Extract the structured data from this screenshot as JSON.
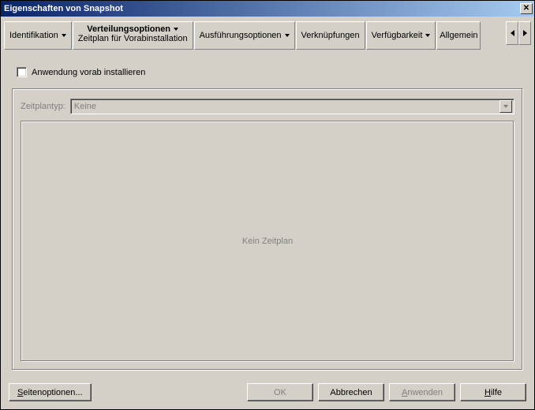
{
  "window": {
    "title": "Eigenschaften von Snapshot"
  },
  "tabs": {
    "identifikation": "Identifikation",
    "verteilung_line1": "Verteilungsoptionen",
    "verteilung_line2": "Zeitplan für Vorabinstallation",
    "ausfuehrung": "Ausführungsoptionen",
    "verknuepfungen": "Verknüpfungen",
    "verfuegbarkeit": "Verfügbarkeit",
    "allgemein": "Allgemein"
  },
  "checkbox": {
    "preinstall": "Anwendung vorab installieren"
  },
  "field": {
    "zeitplantyp_label": "Zeitplantyp:",
    "zeitplantyp_value": "Keine"
  },
  "panel": {
    "empty_text": "Kein Zeitplan"
  },
  "buttons": {
    "page_options": "Seitenoptionen...",
    "ok": "OK",
    "cancel": "Abbrechen",
    "apply": "Anwenden",
    "help": "Hilfe"
  }
}
